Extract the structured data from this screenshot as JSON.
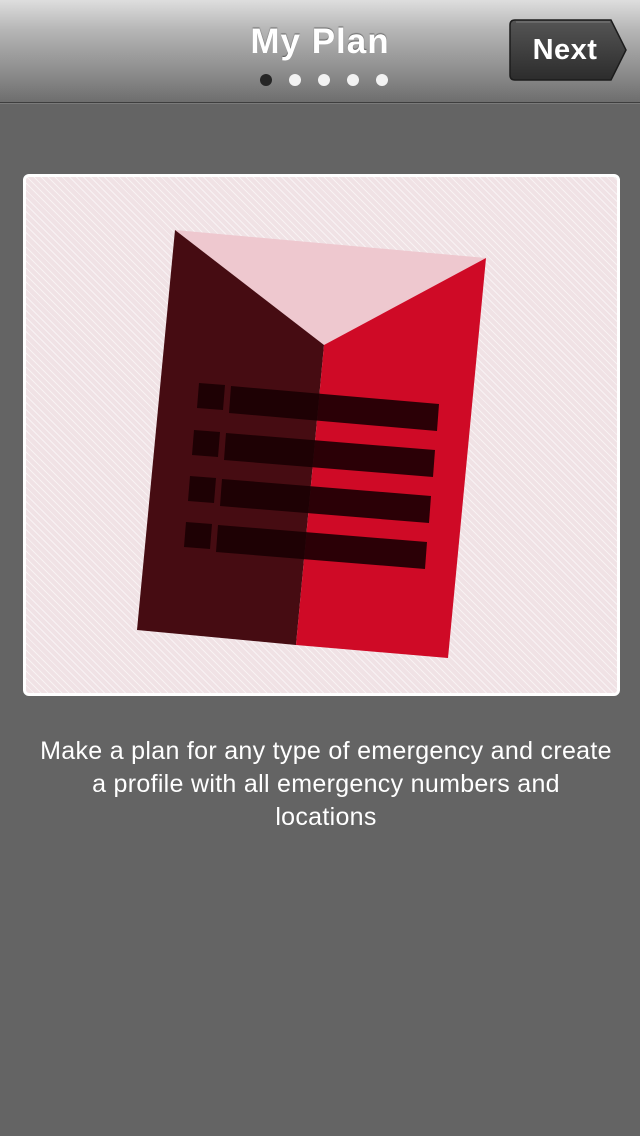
{
  "header": {
    "title": "My Plan",
    "next_label": "Next",
    "page_indicator": {
      "total": 5,
      "current": 1
    }
  },
  "main": {
    "illustration": {
      "icon": "emergency-plan-document-icon",
      "colors": {
        "dark_red": "#460c12",
        "red": "#cf0a26",
        "pink": "#eec8cf",
        "lines": "#1a0003"
      }
    },
    "description": "Make a plan for any type of emergency and create a profile with all emergency numbers and locations"
  },
  "colors": {
    "background": "#646464",
    "card_border": "#ffffff"
  }
}
